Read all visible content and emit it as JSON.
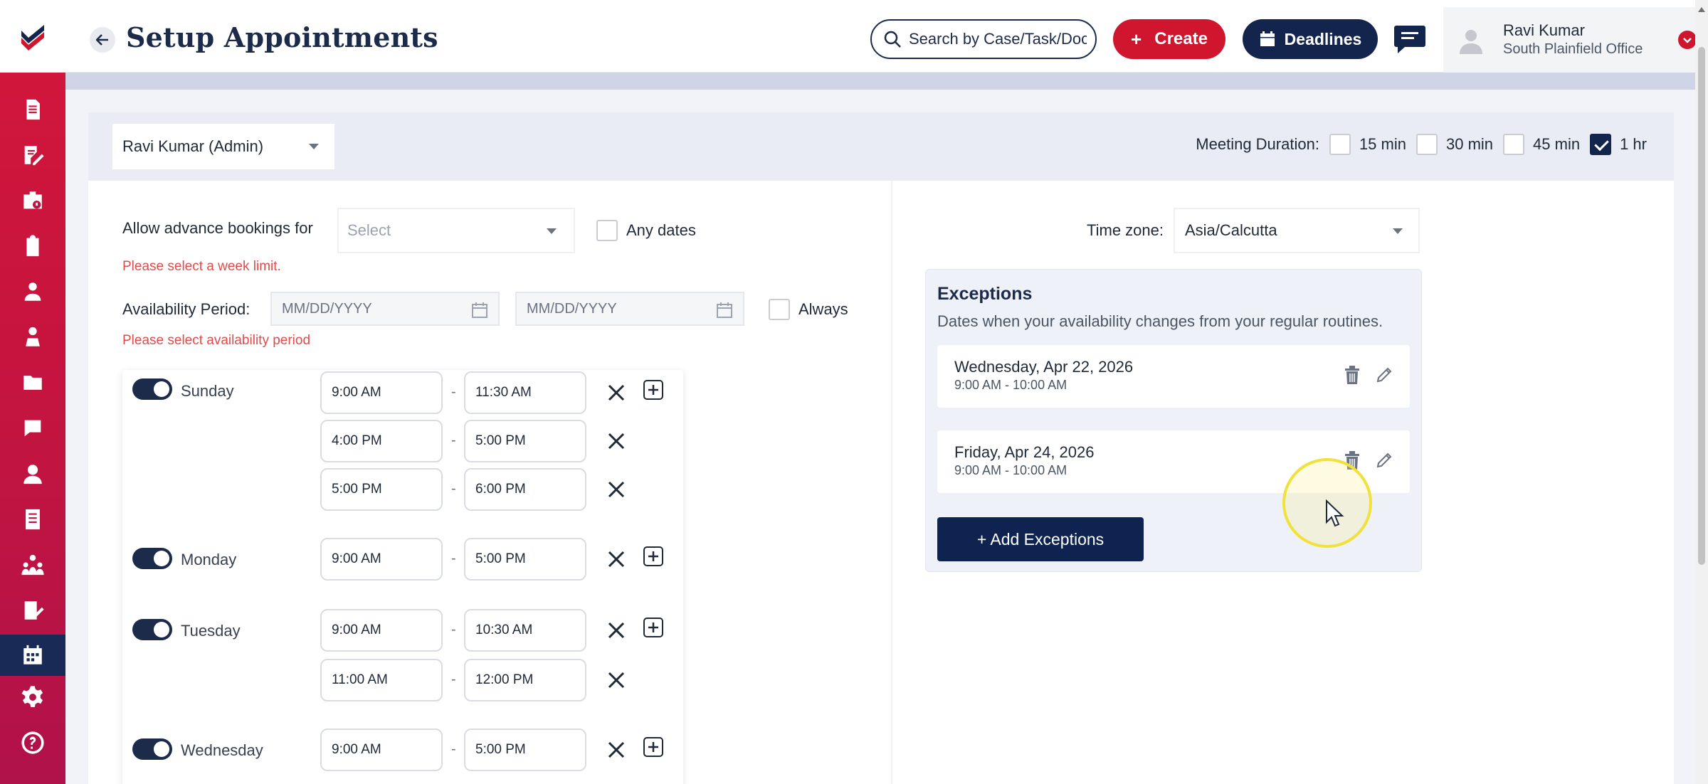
{
  "app": {
    "title": "Setup Appointments"
  },
  "header": {
    "search_placeholder": "Search by Case/Task/Document",
    "create_label": "Create",
    "deadlines_label": "Deadlines",
    "user_name": "Ravi Kumar",
    "user_office": "South Plainfield Office"
  },
  "sidebar": {
    "items": [
      {
        "icon": "document-icon"
      },
      {
        "icon": "notes-icon"
      },
      {
        "icon": "case-icon"
      },
      {
        "icon": "clipboard-icon"
      },
      {
        "icon": "person-icon"
      },
      {
        "icon": "contact-icon"
      },
      {
        "icon": "folder-icon"
      },
      {
        "icon": "chat-icon"
      },
      {
        "icon": "user-icon"
      },
      {
        "icon": "ledger-icon"
      },
      {
        "icon": "team-icon"
      },
      {
        "icon": "form-icon"
      },
      {
        "icon": "calendar-icon",
        "active": true
      },
      {
        "icon": "settings-icon"
      },
      {
        "icon": "help-icon"
      }
    ]
  },
  "topbar": {
    "admin_select": "Ravi Kumar (Admin)",
    "meeting_duration_label": "Meeting Duration:",
    "durations": [
      {
        "label": "15 min",
        "checked": false
      },
      {
        "label": "30 min",
        "checked": false
      },
      {
        "label": "45 min",
        "checked": false
      },
      {
        "label": "1 hr",
        "checked": true
      }
    ]
  },
  "booking": {
    "advance_label": "Allow advance bookings for",
    "advance_placeholder": "Select",
    "any_dates_label": "Any dates",
    "advance_error": "Please select a week limit.",
    "availability_label": "Availability Period:",
    "date_placeholder_start": "MM/DD/YYYY",
    "date_placeholder_end": "MM/DD/YYYY",
    "always_label": "Always",
    "availability_error": "Please select availability period"
  },
  "schedule": [
    {
      "day": "Sunday",
      "enabled": true,
      "slots": [
        [
          "9:00 AM",
          "11:30 AM"
        ],
        [
          "4:00 PM",
          "5:00 PM"
        ],
        [
          "5:00 PM",
          "6:00 PM"
        ]
      ]
    },
    {
      "day": "Monday",
      "enabled": true,
      "slots": [
        [
          "9:00 AM",
          "5:00 PM"
        ]
      ]
    },
    {
      "day": "Tuesday",
      "enabled": true,
      "slots": [
        [
          "9:00 AM",
          "10:30 AM"
        ],
        [
          "11:00 AM",
          "12:00 PM"
        ]
      ]
    },
    {
      "day": "Wednesday",
      "enabled": true,
      "slots": [
        [
          "9:00 AM",
          "5:00 PM"
        ]
      ]
    }
  ],
  "timezone": {
    "label": "Time zone:",
    "value": "Asia/Calcutta"
  },
  "exceptions": {
    "title": "Exceptions",
    "subtitle": "Dates when your availability changes from your regular routines.",
    "items": [
      {
        "date": "Wednesday, Apr 22, 2026",
        "time": "9:00 AM - 10:00 AM"
      },
      {
        "date": "Friday, Apr 24, 2026",
        "time": "9:00 AM - 10:00 AM"
      }
    ],
    "add_label": "+ Add Exceptions"
  },
  "colors": {
    "brand_red": "#d0152e",
    "navy": "#13254d",
    "error": "#e04b4b"
  }
}
